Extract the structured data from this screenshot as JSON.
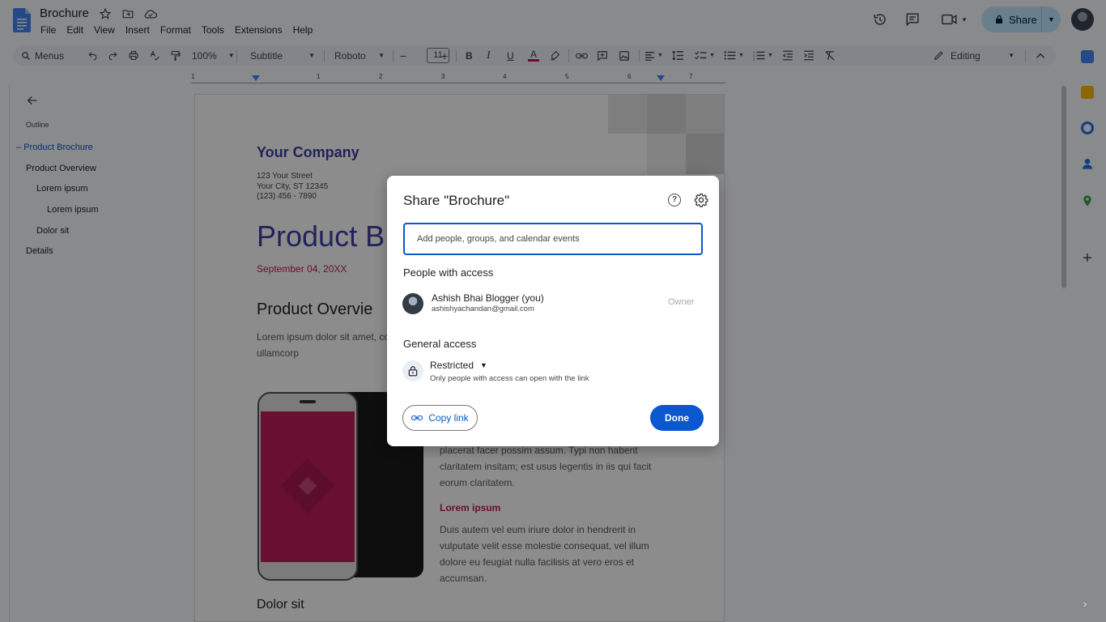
{
  "app": {
    "doc_title": "Brochure",
    "menu": [
      "File",
      "Edit",
      "View",
      "Insert",
      "Format",
      "Tools",
      "Extensions",
      "Help"
    ],
    "share_label": "Share"
  },
  "toolbar": {
    "search_label": "Menus",
    "zoom": "100%",
    "style": "Subtitle",
    "font": "Roboto",
    "font_size": "11",
    "mode": "Editing"
  },
  "ruler": {
    "marks": [
      "1",
      "1",
      "2",
      "3",
      "4",
      "5",
      "6",
      "7"
    ]
  },
  "outline": {
    "label": "Outline",
    "items": [
      {
        "label": "Product Brochure",
        "level": 0,
        "active": true
      },
      {
        "label": "Product Overview",
        "level": 0,
        "active": false
      },
      {
        "label": "Lorem ipsum",
        "level": 1,
        "active": false
      },
      {
        "label": "Lorem ipsum",
        "level": 2,
        "active": false
      },
      {
        "label": "Dolor sit",
        "level": 1,
        "active": false
      },
      {
        "label": "Details",
        "level": 0,
        "active": false
      }
    ]
  },
  "page": {
    "company": "Your Company",
    "address_line1": "123 Your Street",
    "address_line2": "Your City, ST 12345",
    "address_line3": "(123) 456 - 7890",
    "title": "Product B",
    "date": "September 04, 20XX",
    "overview_heading": "Product Overvie",
    "para1": "Lorem ipsum dolor sit amet, co tincidunt ut laoreet dolore mag nostrud exerci tation ullamcorp",
    "para2": "placerat facer possim assum. Typi non habent claritatem insitam; est usus legentis in iis qui facit eorum claritatem.",
    "lorem_heading": "Lorem ipsum",
    "para3": "Duis autem vel eum iriure dolor in hendrerit in vulputate velit esse molestie consequat, vel illum dolore eu feugiat nulla facilisis at vero eros et accumsan.",
    "dolor_heading": "Dolor sit"
  },
  "dialog": {
    "title": "Share \"Brochure\"",
    "input_placeholder": "Add people, groups, and calendar events",
    "people_heading": "People with access",
    "person_name": "Ashish Bhai Blogger (you)",
    "person_email": "ashishyachandan@gmail.com",
    "person_role": "Owner",
    "general_heading": "General access",
    "access_value": "Restricted",
    "access_desc": "Only people with access can open with the link",
    "copy_link": "Copy link",
    "done": "Done"
  },
  "colors": {
    "accent": "#0b57d0",
    "share_bg": "#c2e7ff",
    "brand_purple": "#3b3fa3",
    "brand_pink": "#c2185b"
  }
}
